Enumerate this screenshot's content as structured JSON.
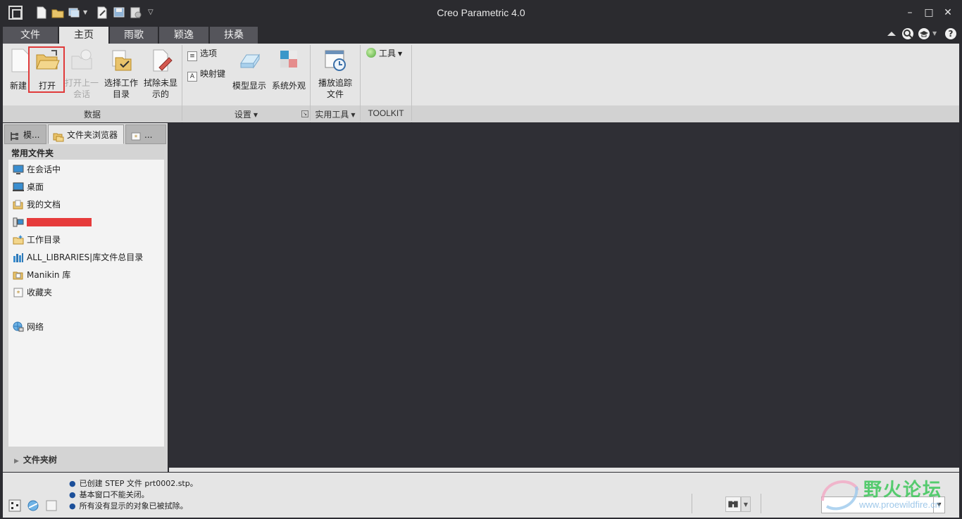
{
  "window": {
    "title": "Creo Parametric 4.0",
    "minimize": "–",
    "maximize": "□",
    "close": "✕"
  },
  "tabs": [
    {
      "label": "文件"
    },
    {
      "label": "主页"
    },
    {
      "label": "雨歌"
    },
    {
      "label": "颖逸"
    },
    {
      "label": "扶桑"
    }
  ],
  "ribbon": {
    "new": "新建",
    "open": "打开",
    "open_last_1": "打开上一",
    "open_last_2": "会话",
    "select_wd_1": "选择工作",
    "select_wd_2": "目录",
    "erase_1": "拭除未显",
    "erase_2": "示的",
    "options": "选项",
    "mapkeys": "映射键",
    "model_display": "模型显示",
    "system_appearance": "系统外观",
    "play_trail_1": "播放追踪",
    "play_trail_2": "文件",
    "tools": "工具",
    "group_data": "数据",
    "group_settings": "设置",
    "group_utilities": "实用工具",
    "group_toolkit": "TOOLKIT"
  },
  "navigator": {
    "tab_model": "模...",
    "tab_folder": "文件夹浏览器",
    "tab_fav": "...",
    "section_title": "常用文件夹",
    "items": [
      {
        "label": "在会话中"
      },
      {
        "label": "桌面"
      },
      {
        "label": "我的文档"
      },
      {
        "label": ""
      },
      {
        "label": "工作目录"
      },
      {
        "label": "ALL_LIBRARIES|库文件总目录"
      },
      {
        "label": "Manikin 库"
      },
      {
        "label": "收藏夹"
      },
      {
        "label": "网络"
      }
    ],
    "folder_tree": "文件夹树"
  },
  "status": {
    "messages": [
      "已创建 STEP 文件 prt0002.stp。",
      "基本窗口不能关闭。",
      "所有没有显示的对象已被拭除。"
    ]
  },
  "watermark": {
    "text": "野火论坛",
    "url": "www.proewildfire.cn"
  },
  "colors": {
    "highlight": "#e03a3a",
    "graphics_bg": "#2f2f35",
    "ribbon_bg": "#e5e5e5"
  }
}
